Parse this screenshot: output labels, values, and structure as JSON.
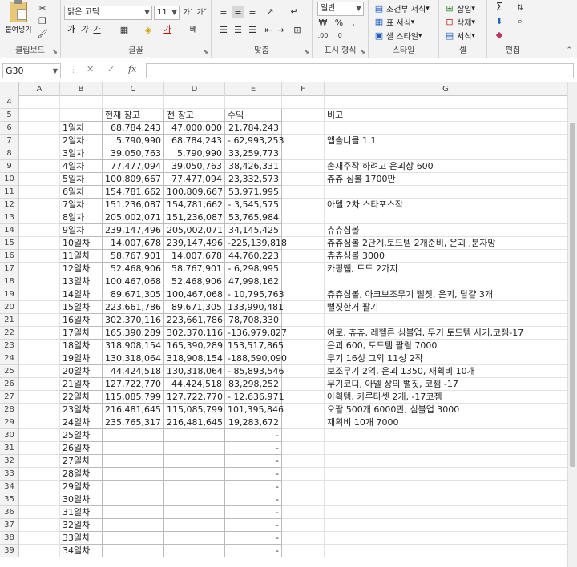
{
  "ribbon": {
    "clipboard": {
      "paste_label": "붙여넣기",
      "group_label": "클립보드"
    },
    "font": {
      "font_name": "맑은 고딕",
      "font_size": "11",
      "group_label": "글꼴"
    },
    "align": {
      "group_label": "맞춤"
    },
    "number": {
      "format": "일반",
      "group_label": "표시 형식"
    },
    "styles": {
      "cond_format": "조건부 서식",
      "table_format": "표 서식",
      "cell_style": "셀 스타일",
      "group_label": "스타일"
    },
    "cells": {
      "insert": "삽입",
      "delete": "삭제",
      "format": "서식",
      "group_label": "셀"
    },
    "editing": {
      "group_label": "편집"
    }
  },
  "formula_bar": {
    "name_box": "G30",
    "cancel": "✕",
    "enter": "✓",
    "fx": "fx"
  },
  "columns": [
    "A",
    "B",
    "C",
    "D",
    "E",
    "F",
    "G"
  ],
  "rows": [
    {
      "n": "4",
      "b": "",
      "c": "",
      "d": "",
      "e": "",
      "g": ""
    },
    {
      "n": "5",
      "b": "",
      "c": "현재 창고",
      "d": "전 창고",
      "e": "수익",
      "g": "비고"
    },
    {
      "n": "6",
      "b": "1일차",
      "c": "68,784,243",
      "d": "47,000,000",
      "e": "21,784,243",
      "g": ""
    },
    {
      "n": "7",
      "b": "2일차",
      "c": "5,790,990",
      "d": "68,784,243",
      "e": "- 62,993,253",
      "g": "앱솔너클 1.1"
    },
    {
      "n": "8",
      "b": "3일차",
      "c": "39,050,763",
      "d": "5,790,990",
      "e": "33,259,773",
      "g": ""
    },
    {
      "n": "9",
      "b": "4일차",
      "c": "77,477,094",
      "d": "39,050,763",
      "e": "38,426,331",
      "g": "손재주작 하려고 은괴상 600"
    },
    {
      "n": "10",
      "b": "5일차",
      "c": "100,809,667",
      "d": "77,477,094",
      "e": "23,332,573",
      "g": "츄츄 심볼 1700만"
    },
    {
      "n": "11",
      "b": "6일차",
      "c": "154,781,662",
      "d": "100,809,667",
      "e": "53,971,995",
      "g": ""
    },
    {
      "n": "12",
      "b": "7일차",
      "c": "151,236,087",
      "d": "154,781,662",
      "e": "- 3,545,575",
      "g": "아델 2차 스타포스작"
    },
    {
      "n": "13",
      "b": "8일차",
      "c": "205,002,071",
      "d": "151,236,087",
      "e": "53,765,984",
      "g": ""
    },
    {
      "n": "14",
      "b": "9일차",
      "c": "239,147,496",
      "d": "205,002,071",
      "e": "34,145,425",
      "g": "츄츄심볼"
    },
    {
      "n": "15",
      "b": "10일차",
      "c": "14,007,678",
      "d": "239,147,496",
      "e": "-225,139,818",
      "g": "츄츄심볼 2단계,토드템 2개준비, 은괴 ,분자망"
    },
    {
      "n": "16",
      "b": "11일차",
      "c": "58,767,901",
      "d": "14,007,678",
      "e": "44,760,223",
      "g": "츄츄심볼 3000"
    },
    {
      "n": "17",
      "b": "12일차",
      "c": "52,468,906",
      "d": "58,767,901",
      "e": "- 6,298,995",
      "g": "카핑뷈, 토드 2가지"
    },
    {
      "n": "18",
      "b": "13일차",
      "c": "100,467,068",
      "d": "52,468,906",
      "e": "47,998,162",
      "g": ""
    },
    {
      "n": "19",
      "b": "14일차",
      "c": "89,671,305",
      "d": "100,467,068",
      "e": "- 10,795,763",
      "g": "츄츄심볼, 아크보조무기 뻘짓, 은괴, 닽걀 3개"
    },
    {
      "n": "20",
      "b": "15일차",
      "c": "223,661,786",
      "d": "89,671,305",
      "e": "133,990,481",
      "g": "뻘짓한거 팔기"
    },
    {
      "n": "21",
      "b": "16일차",
      "c": "302,370,116",
      "d": "223,661,786",
      "e": "78,708,330",
      "g": ""
    },
    {
      "n": "22",
      "b": "17일차",
      "c": "165,390,289",
      "d": "302,370,116",
      "e": "-136,979,827",
      "g": "여로, 츄츄, 레헬른 심볼업, 무기 토드템 사기,코젬-17"
    },
    {
      "n": "23",
      "b": "18일차",
      "c": "318,908,154",
      "d": "165,390,289",
      "e": "153,517,865",
      "g": "은괴 600, 토드템 팔림 7000"
    },
    {
      "n": "24",
      "b": "19일차",
      "c": "130,318,064",
      "d": "318,908,154",
      "e": "-188,590,090",
      "g": "무기 16성 그외 11성 2작"
    },
    {
      "n": "25",
      "b": "20일차",
      "c": "44,424,518",
      "d": "130,318,064",
      "e": "- 85,893,546",
      "g": "보조무기 2억, 은괴 1350, 재획비 10개"
    },
    {
      "n": "26",
      "b": "21일차",
      "c": "127,722,770",
      "d": "44,424,518",
      "e": "83,298,252",
      "g": "무기코디, 아델 상의 뻘짓, 코젬 -17"
    },
    {
      "n": "27",
      "b": "22일차",
      "c": "115,085,799",
      "d": "127,722,770",
      "e": "- 12,636,971",
      "g": "아획템, 카루타셋 2개, -17코젬"
    },
    {
      "n": "28",
      "b": "23일차",
      "c": "216,481,645",
      "d": "115,085,799",
      "e": "101,395,846",
      "g": "오팔 500개 6000만, 심볼업 3000"
    },
    {
      "n": "29",
      "b": "24일차",
      "c": "235,765,317",
      "d": "216,481,645",
      "e": "19,283,672",
      "g": "재획비 10개 7000"
    },
    {
      "n": "30",
      "b": "25일차",
      "c": "",
      "d": "",
      "e": "-",
      "g": ""
    },
    {
      "n": "31",
      "b": "26일차",
      "c": "",
      "d": "",
      "e": "-",
      "g": ""
    },
    {
      "n": "32",
      "b": "27일차",
      "c": "",
      "d": "",
      "e": "-",
      "g": ""
    },
    {
      "n": "33",
      "b": "28일차",
      "c": "",
      "d": "",
      "e": "-",
      "g": ""
    },
    {
      "n": "34",
      "b": "29일차",
      "c": "",
      "d": "",
      "e": "-",
      "g": ""
    },
    {
      "n": "35",
      "b": "30일차",
      "c": "",
      "d": "",
      "e": "-",
      "g": ""
    },
    {
      "n": "36",
      "b": "31일차",
      "c": "",
      "d": "",
      "e": "-",
      "g": ""
    },
    {
      "n": "37",
      "b": "32일차",
      "c": "",
      "d": "",
      "e": "-",
      "g": ""
    },
    {
      "n": "38",
      "b": "33일차",
      "c": "",
      "d": "",
      "e": "-",
      "g": ""
    },
    {
      "n": "39",
      "b": "34일차",
      "c": "",
      "d": "",
      "e": "-",
      "g": ""
    }
  ]
}
